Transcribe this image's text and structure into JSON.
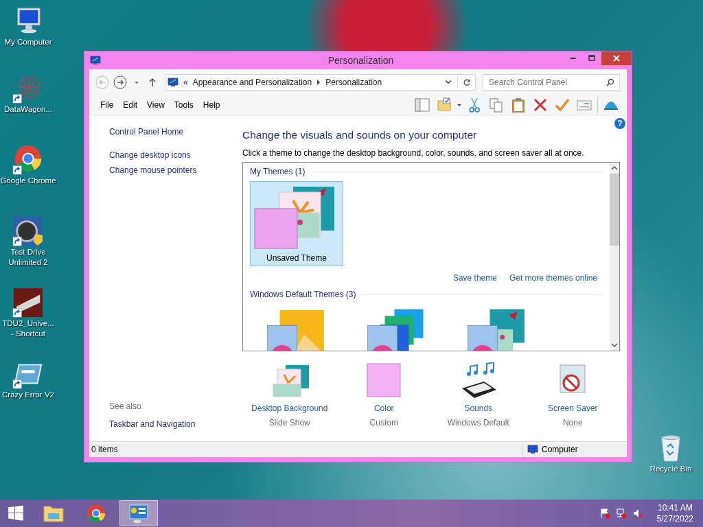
{
  "desktop_icons": [
    {
      "label": "My Computer",
      "kind": "computer",
      "shortcut": false
    },
    {
      "label": "DataWagon...",
      "kind": "network",
      "shortcut": true
    },
    {
      "label": "Google Chrome",
      "kind": "chrome",
      "shortcut": true
    },
    {
      "label": "Test Drive Unlimited 2",
      "kind": "wheel",
      "shortcut": true
    },
    {
      "label": "TDU2_Unive... - Shortcut",
      "kind": "game",
      "shortcut": true
    },
    {
      "label": "Crazy Error V2",
      "kind": "window",
      "shortcut": true
    }
  ],
  "recycle_bin": {
    "label": "Recycle Bin"
  },
  "window": {
    "title": "Personalization",
    "address": {
      "prefix": "«",
      "crumbs": [
        "Appearance and Personalization",
        "Personalization"
      ]
    },
    "search": {
      "placeholder": "Search Control Panel"
    },
    "menu": [
      "File",
      "Edit",
      "View",
      "Tools",
      "Help"
    ],
    "sidebar": {
      "items": [
        "Control Panel Home",
        "Change desktop icons",
        "Change mouse pointers"
      ],
      "see_also_title": "See also",
      "see_also": [
        "Taskbar and Navigation"
      ]
    },
    "help_button": "?",
    "heading": "Change the visuals and sounds on your computer",
    "description": "Click a theme to change the desktop background, color, sounds, and screen saver all at once.",
    "theme_groups": [
      {
        "title": "My Themes (1)",
        "themes": [
          {
            "label": "Unsaved Theme",
            "kind": "custom",
            "selected": true
          }
        ],
        "links": [
          "Save theme",
          "Get more themes online"
        ]
      },
      {
        "title": "Windows Default Themes (3)",
        "themes": [
          {
            "kind": "yellow",
            "selected": false
          },
          {
            "kind": "blue",
            "selected": false
          },
          {
            "kind": "flower",
            "selected": false
          }
        ]
      }
    ],
    "settings": [
      {
        "kind": "background",
        "label": "Desktop Background",
        "value": "Slide Show"
      },
      {
        "kind": "color",
        "label": "Color",
        "value": "Custom"
      },
      {
        "kind": "sounds",
        "label": "Sounds",
        "value": "Windows Default"
      },
      {
        "kind": "screensaver",
        "label": "Screen Saver",
        "value": "None"
      }
    ],
    "status_bar": {
      "count": "0 items",
      "location": "Computer"
    }
  },
  "taskbar": {
    "apps": [
      {
        "kind": "explorer",
        "selected": false
      },
      {
        "kind": "chrome",
        "selected": false
      },
      {
        "kind": "control-panel",
        "selected": true
      }
    ],
    "time": "10:41 AM",
    "date": "5/27/2022"
  }
}
